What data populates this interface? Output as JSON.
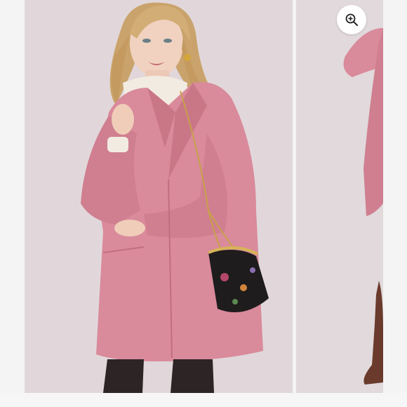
{
  "gallery": {
    "main_image": {
      "alt": ""
    },
    "next_image": {
      "alt": ""
    },
    "zoom_button": {
      "icon": "zoom-in-icon"
    }
  },
  "colors": {
    "coat": "#d98a9b",
    "background": "#ddd3d6",
    "page": "#f4f4f4"
  }
}
